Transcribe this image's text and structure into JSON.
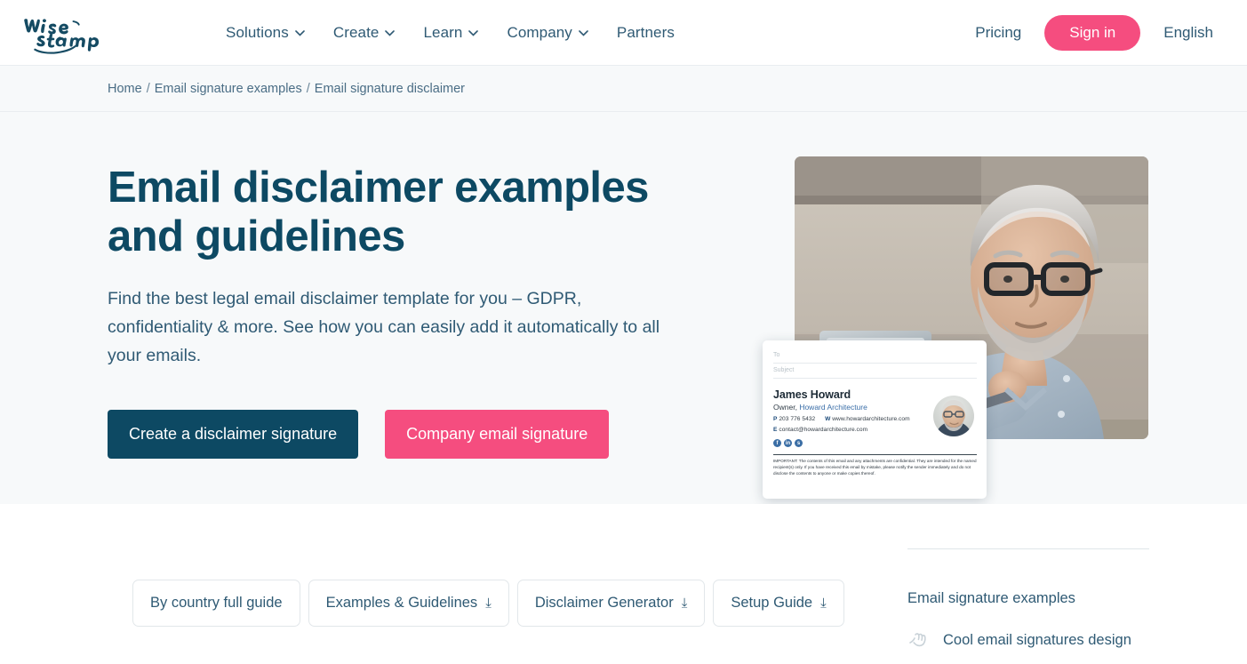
{
  "header": {
    "logo_alt": "WiseStamp",
    "nav": [
      {
        "label": "Solutions",
        "has_chevron": true
      },
      {
        "label": "Create",
        "has_chevron": true
      },
      {
        "label": "Learn",
        "has_chevron": true
      },
      {
        "label": "Company",
        "has_chevron": true
      },
      {
        "label": "Partners",
        "has_chevron": false
      }
    ],
    "pricing": "Pricing",
    "signin": "Sign in",
    "language": "English"
  },
  "breadcrumb": {
    "home": "Home",
    "sep1": "/",
    "level2": "Email signature examples",
    "sep2": "/",
    "current": "Email signature disclaimer"
  },
  "hero": {
    "title": "Email disclaimer examples and guidelines",
    "subtitle": "Find the best legal email disclaimer template for you – GDPR, confidentiality & more. See how you can easily add it automatically to all your emails.",
    "primary_button": "Create a disclaimer signature",
    "secondary_button": "Company email signature"
  },
  "signature_card": {
    "to_placeholder": "To",
    "subject_placeholder": "Subject",
    "name": "James Howard",
    "role_prefix": "Owner,",
    "company": "Howard Architecture",
    "phone_label": "P",
    "phone": "203 776 5432",
    "web_label": "W",
    "web": "www.howardarchitecture.com",
    "email_label": "E",
    "email": "contact@howardarchitecture.com",
    "social": [
      "facebook-icon",
      "linkedin-icon",
      "skype-icon"
    ],
    "disclaimer": "IMPORTANT: The contents of this email and any attachments are confidential. They are intended for the named recipient(s) only. If you have received this email by mistake, please notify the sender immediately and do not disclose the contents to anyone or make copies thereof."
  },
  "tabs": [
    {
      "label": "By country full guide",
      "arrow": ""
    },
    {
      "label": "Examples & Guidelines",
      "arrow": "⤓"
    },
    {
      "label": "Disclaimer Generator",
      "arrow": "⤓"
    },
    {
      "label": "Setup Guide",
      "arrow": "⤓"
    }
  ],
  "rail": {
    "title": "Email signature examples",
    "items": [
      {
        "label": "Cool email signatures design",
        "icon": "signature-hand-icon"
      }
    ]
  },
  "colors": {
    "brand_navy": "#0d4963",
    "brand_pink": "#f54d7f",
    "text_muted": "#2f5a74",
    "hero_bg": "#f7f9fa",
    "border": "#e9edf0"
  }
}
